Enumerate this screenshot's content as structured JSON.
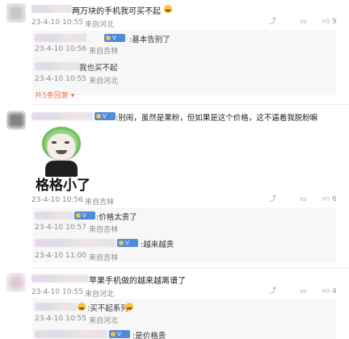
{
  "comments": [
    {
      "text": "两万块的手机我可买不起",
      "time": "23-4-10 10:55",
      "location": "来自河北",
      "likes": "9",
      "replies": [
        {
          "text": ":基本告别了",
          "time": "23-4-10 10:56",
          "location": "来自吉林"
        },
        {
          "text": "我也买不起",
          "time": "23-4-10 10:55",
          "location": "来自河北"
        }
      ],
      "more_replies": "共5条回复"
    },
    {
      "text": ":别闹，虽然是果粉，但如果是这个价格，这不逼着我脱粉嘛",
      "sticker_caption": "格格小了",
      "time": "23-4-10 10:56",
      "location": "来自吉林",
      "likes": "6",
      "replies": [
        {
          "text": ":价格太贵了",
          "time": "23-4-10 10:57",
          "location": "来自吉林"
        },
        {
          "text": ":越来越贵",
          "time": "23-4-10 11:00",
          "location": "来自吉林"
        }
      ]
    },
    {
      "text": "苹果手机做的越来越离谱了",
      "time": "23-4-10 10:55",
      "location": "来自河北",
      "likes": "4",
      "replies": [
        {
          "text": ":买不起系列",
          "time": "23-4-10 10:55",
          "location": "来自河北"
        },
        {
          "text": ":是价格贵",
          "time": "",
          "location": ""
        }
      ]
    }
  ],
  "icons": {
    "share": "share-icon",
    "comment": "comment-icon",
    "like": "thumb-up-icon"
  },
  "colors": {
    "more_link": "#eb7350",
    "badge": "#4f8bd9"
  }
}
